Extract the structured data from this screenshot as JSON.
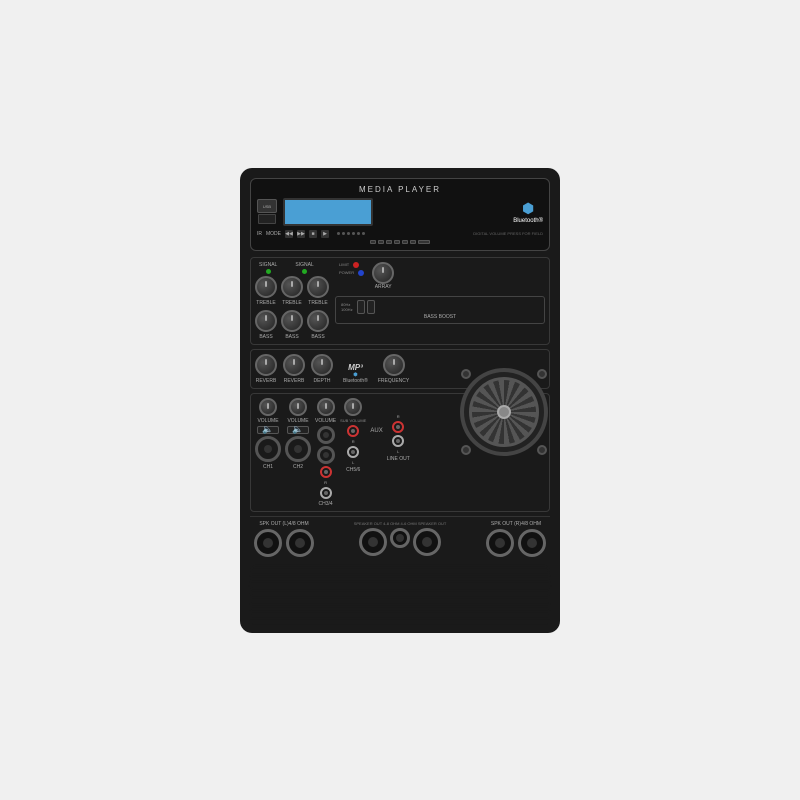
{
  "panel": {
    "title": "MEDIA PLAYER",
    "bluetooth_label": "Bluetooth®",
    "usb_label": "USB",
    "ir_label": "IR",
    "mode_label": "MODE",
    "digital_vol": "DIGITAL VOLUME\nPRESS FOR FIELD",
    "signal_label": "SIGNAL",
    "treble_label": "TREBLE",
    "bass_label": "BASS",
    "reverb_label": "REVERB",
    "depth_label": "DEPTH",
    "volume_label": "VOLUME",
    "limit_label": "LIMIT",
    "power_label": "POWER",
    "array_label": "ARRAY",
    "frequency_label": "FREQUENCY",
    "bass_boost_label": "BASS BOOST",
    "freq1": "80Hz",
    "freq2": "100Hz",
    "ch1_label": "CH1",
    "ch2_label": "CH2",
    "ch3_label": "CH3/4",
    "ch56_label": "CH5/6",
    "line_out_label": "LINE OUT",
    "aux_label": "AUX",
    "spk_out_l_label": "SPK OUT\n(L)4/8 OHM",
    "spk_out_r_label": "SPK OUT\n(R)4/8 OHM",
    "speaker_out_label": "SPEAKER OUT\n4-8 OHM\n4-6 OHM\nSPEAKER OUT",
    "sub_volume_label": "SUB\nVOLUME",
    "mp3_label": "MP³",
    "mp3_bluetooth": "Bluetooth®"
  }
}
